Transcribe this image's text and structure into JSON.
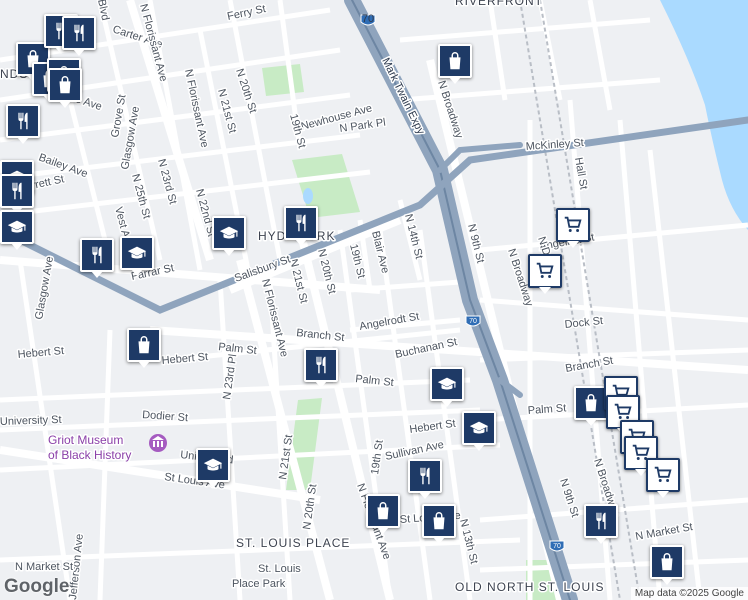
{
  "neighborhoods": {
    "riverfront": "RIVERFRONT",
    "hyde_park": "HYDE PARK",
    "st_louis_place": "ST. LOUIS PLACE",
    "old_north": "OLD NORTH ST. LOUIS",
    "nds": "NDS"
  },
  "highways": {
    "i70_north": "70",
    "i70_mid": "70",
    "i70_south": "70",
    "mark_twain": "Mark Twain Expy"
  },
  "streets": {
    "ferry": "Ferry St",
    "carter": "Carter Ave",
    "n_florissant_top": "N Florissant Ave",
    "n_florissant_mid": "N Florissant Ave",
    "n_florissant_low": "N Florissant Ave",
    "n_florissant_bottom": "N Florissant Ave",
    "lee": "Lee Ave",
    "n_20th_top": "N 20th St",
    "n_20th_mid": "N 20th St",
    "n_20th_low": "N 20th St",
    "n_21st_top": "N 21st St",
    "n_21st_mid": "N 21st St",
    "n_21st_low": "N 21st St",
    "newhouse": "Newhouse Ave",
    "n_park": "N Park Pl",
    "nineteenth_top": "19th St",
    "nineteenth_mid": "19th St",
    "nineteenth_low": "19th St",
    "grove": "Grove St",
    "glasgow": "Glasgow Ave",
    "glasgow_low": "Glasgow Ave",
    "n_25th": "N 25th St",
    "n_23rd": "N 23rd St",
    "n_23rd_low": "N 23rd Pl",
    "n_22nd": "N 22nd St",
    "bailey": "Bailey Ave",
    "garrett": "Garrett St",
    "vest": "Vest Ave",
    "farrar": "Farrar St",
    "salisbury": "Salisbury St",
    "blair": "Blair Ave",
    "n_14th": "N 14th St",
    "n_9th": "N 9th St",
    "n_9th_low": "N 9th St",
    "n_broadway": "N Broadway",
    "n_broadway_top": "N Broadway",
    "n_broadway_low": "N Broadway",
    "mckinley": "McKinley St",
    "hall": "Hall St",
    "angelica": "Angelica St",
    "dock": "Dock St",
    "hebert_left": "Hebert St",
    "hebert_mid": "Hebert St",
    "hebert_low": "Hebert St",
    "palm_left": "Palm St",
    "palm_mid": "Palm St",
    "palm_right": "Palm St",
    "branch": "Branch St",
    "branch_right": "Branch St",
    "angelrodt": "Angelrodt St",
    "buchanan": "Buchanan St",
    "university": "University St",
    "dodier": "Dodier St",
    "union": "Union Blvd",
    "st_louis": "St Louis Ave",
    "st_louis_low": "St Louis Ave",
    "sullivan": "Sullivan Ave",
    "jefferson": "Jefferson Ave",
    "n_market": "N Market St",
    "n_market_right": "N Market St",
    "n_13th": "N 13th St",
    "blvd": "Blvd",
    "nd": "N D"
  },
  "poi": {
    "griot_line1": "Griot Museum",
    "griot_line2": "of Black History",
    "park_line1": "St. Louis",
    "park_line2": "Place Park"
  },
  "markers": [
    {
      "type": "shopping",
      "name": "shopping-marker-1"
    },
    {
      "type": "restaurant",
      "name": "restaurant-marker-1"
    },
    {
      "type": "restaurant",
      "name": "restaurant-marker-2"
    },
    {
      "type": "shopping",
      "name": "shopping-marker-2"
    },
    {
      "type": "shopping",
      "name": "shopping-marker-3"
    },
    {
      "type": "shopping",
      "name": "shopping-marker-4"
    },
    {
      "type": "restaurant",
      "name": "restaurant-marker-3"
    },
    {
      "type": "school",
      "name": "school-marker-1"
    },
    {
      "type": "restaurant",
      "name": "restaurant-marker-4"
    },
    {
      "type": "school",
      "name": "school-marker-2"
    },
    {
      "type": "restaurant",
      "name": "restaurant-marker-5"
    },
    {
      "type": "school",
      "name": "school-marker-3"
    },
    {
      "type": "school",
      "name": "school-marker-4"
    },
    {
      "type": "restaurant",
      "name": "restaurant-marker-6"
    },
    {
      "type": "shopping",
      "name": "shopping-marker-5"
    },
    {
      "type": "grocery",
      "name": "grocery-marker-1"
    },
    {
      "type": "grocery",
      "name": "grocery-marker-2"
    },
    {
      "type": "shopping",
      "name": "shopping-marker-6"
    },
    {
      "type": "restaurant",
      "name": "restaurant-marker-7"
    },
    {
      "type": "school",
      "name": "school-marker-5"
    },
    {
      "type": "school",
      "name": "school-marker-6"
    },
    {
      "type": "shopping",
      "name": "shopping-marker-7"
    },
    {
      "type": "grocery",
      "name": "grocery-marker-3"
    },
    {
      "type": "grocery",
      "name": "grocery-marker-4"
    },
    {
      "type": "grocery",
      "name": "grocery-marker-5"
    },
    {
      "type": "grocery",
      "name": "grocery-marker-6"
    },
    {
      "type": "grocery",
      "name": "grocery-marker-7"
    },
    {
      "type": "school",
      "name": "school-marker-7"
    },
    {
      "type": "restaurant",
      "name": "restaurant-marker-8"
    },
    {
      "type": "shopping",
      "name": "shopping-marker-8"
    },
    {
      "type": "shopping",
      "name": "shopping-marker-9"
    },
    {
      "type": "restaurant",
      "name": "restaurant-marker-9"
    },
    {
      "type": "shopping",
      "name": "shopping-marker-10"
    }
  ],
  "colors": {
    "water": "#aadaff",
    "highway": "#8fa4bd",
    "park": "#c8ebc5",
    "marker": "#1e3a66"
  },
  "branding": {
    "logo": "Google",
    "attribution": "Map data ©2025 Google"
  }
}
